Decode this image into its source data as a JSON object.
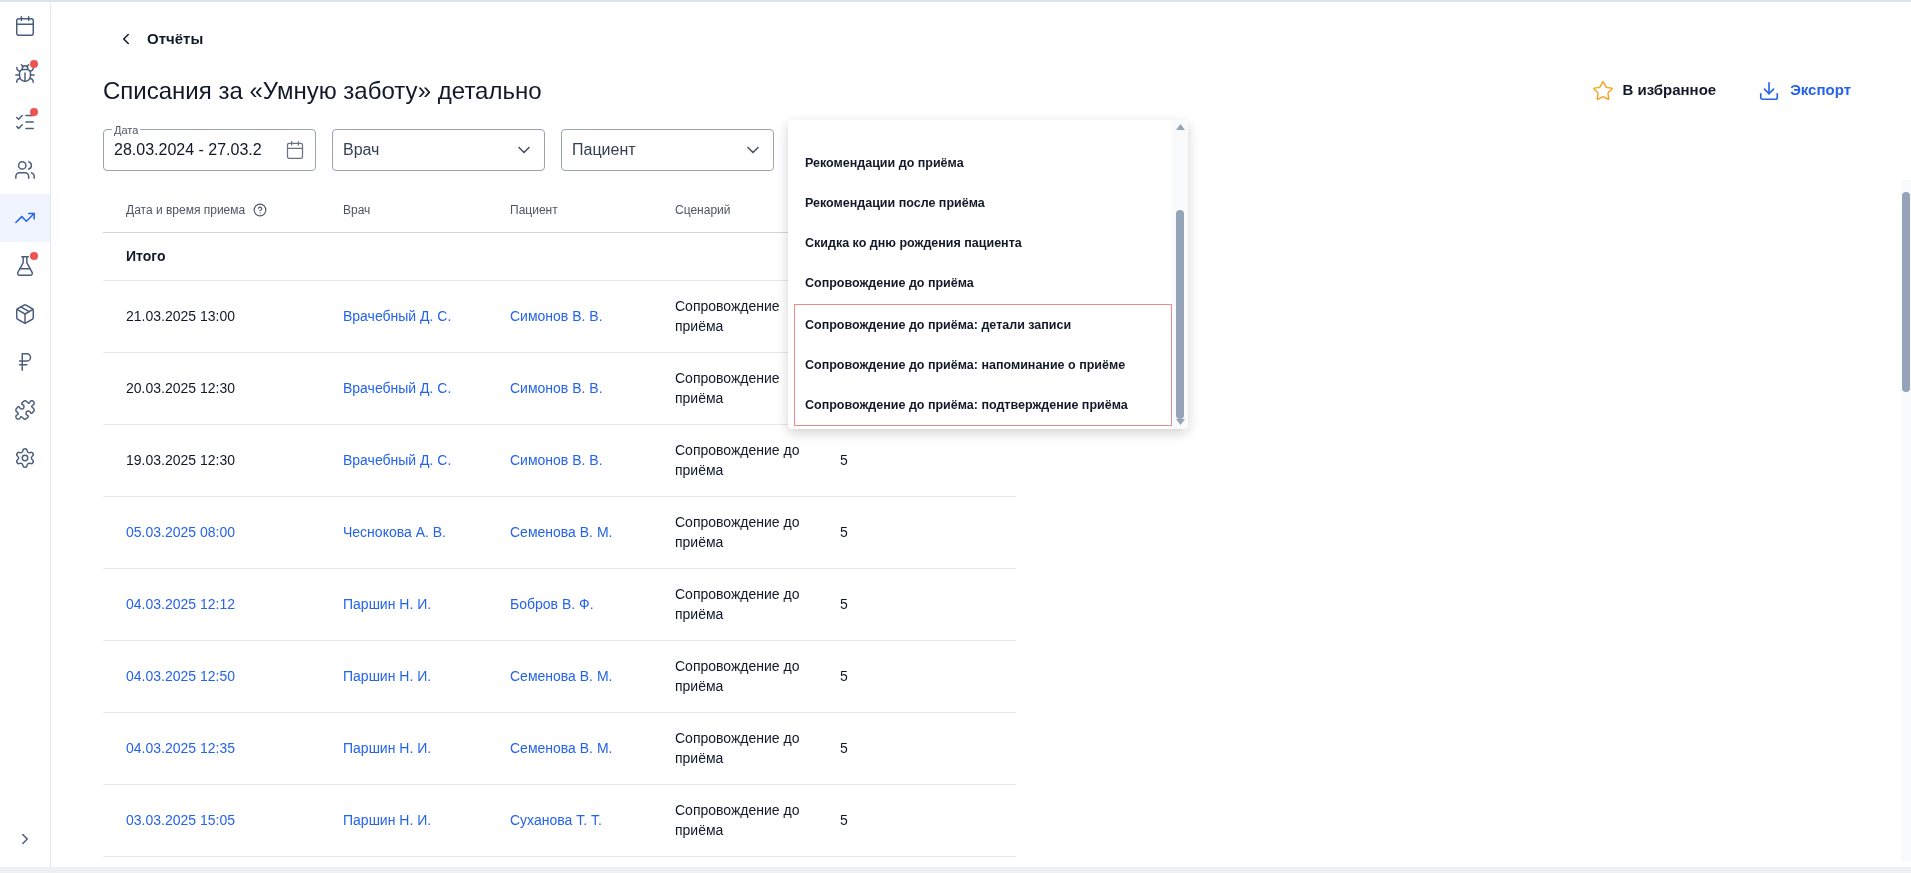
{
  "sidebar": {
    "items": [
      {
        "selected": false,
        "badge": false
      },
      {
        "selected": false,
        "badge": true
      },
      {
        "selected": false,
        "badge": true
      },
      {
        "selected": false,
        "badge": false
      },
      {
        "selected": true,
        "badge": false
      },
      {
        "selected": false,
        "badge": true
      },
      {
        "selected": false,
        "badge": false
      },
      {
        "selected": false,
        "badge": false
      },
      {
        "selected": false,
        "badge": false
      },
      {
        "selected": false,
        "badge": false
      }
    ]
  },
  "back_link": "Отчёты",
  "title": "Списания за «Умную заботу» детально",
  "actions": {
    "favorite": "В избранное",
    "export": "Экспорт"
  },
  "filters": {
    "date": {
      "label": "Дата",
      "value": "28.03.2024 - 27.03.2"
    },
    "doctor": {
      "placeholder": "Врач"
    },
    "patient": {
      "placeholder": "Пациент"
    }
  },
  "dropdown": {
    "options": [
      {
        "label": "Рекомендации до приёма",
        "marked": false
      },
      {
        "label": "Рекомендации после приёма",
        "marked": false
      },
      {
        "label": "Скидка ко дню рождения пациента",
        "marked": false
      },
      {
        "label": "Сопровождение до приёма",
        "marked": false
      },
      {
        "label": "Сопровождение до приёма: детали записи",
        "marked": true
      },
      {
        "label": "Сопровождение до приёма: напоминание о приёме",
        "marked": true
      },
      {
        "label": "Сопровождение до приёма: подтверждение приёма",
        "marked": true
      }
    ]
  },
  "table": {
    "columns": [
      "Дата и время приема",
      "Врач",
      "Пациент",
      "Сценарий"
    ],
    "total_label": "Итого",
    "rows": [
      {
        "date": "21.03.2025 13:00",
        "date_link": false,
        "doctor": "Врачебный Д. С.",
        "patient": "Симонов В. В.",
        "scenario": "Сопровождение приёма"
      },
      {
        "date": "20.03.2025 12:30",
        "date_link": false,
        "doctor": "Врачебный Д. С.",
        "patient": "Симонов В. В.",
        "scenario": "Сопровождение приёма"
      },
      {
        "date": "19.03.2025 12:30",
        "date_link": false,
        "doctor": "Врачебный Д. С.",
        "patient": "Симонов В. В.",
        "scenario": "Сопровождение до приёма",
        "count": "5"
      },
      {
        "date": "05.03.2025 08:00",
        "date_link": true,
        "doctor": "Чеснокова А. В.",
        "patient": "Семенова В. М.",
        "scenario": "Сопровождение до приёма",
        "count": "5"
      },
      {
        "date": "04.03.2025 12:12",
        "date_link": true,
        "doctor": "Паршин Н. И.",
        "patient": "Бобров В. Ф.",
        "scenario": "Сопровождение до приёма",
        "count": "5"
      },
      {
        "date": "04.03.2025 12:50",
        "date_link": true,
        "doctor": "Паршин Н. И.",
        "patient": "Семенова В. М.",
        "scenario": "Сопровождение до приёма",
        "count": "5"
      },
      {
        "date": "04.03.2025 12:35",
        "date_link": true,
        "doctor": "Паршин Н. И.",
        "patient": "Семенова В. М.",
        "scenario": "Сопровождение до приёма",
        "count": "5"
      },
      {
        "date": "03.03.2025 15:05",
        "date_link": true,
        "doctor": "Паршин Н. И.",
        "patient": "Суханова Т. Т.",
        "scenario": "Сопровождение до приёма",
        "count": "5"
      }
    ]
  }
}
